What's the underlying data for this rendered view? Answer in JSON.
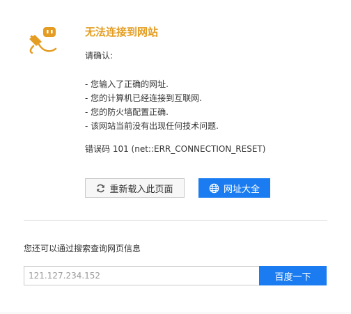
{
  "error": {
    "icon": "unplugged-plug-icon",
    "title": "无法连接到网站",
    "confirm_label": "请确认:",
    "checks": [
      "- 您输入了正确的网址.",
      "- 您的计算机已经连接到互联网.",
      "- 您的防火墙配置正确.",
      "- 该网站当前没有出现任何技术问题."
    ],
    "error_code": "错误码 101 (net::ERR_CONNECTION_RESET)"
  },
  "actions": {
    "reload_label": "重新载入此页面",
    "reload_icon": "refresh-icon",
    "sites_label": "网址大全",
    "sites_icon": "globe-icon"
  },
  "search": {
    "label": "您还可以通过搜索查询网页信息",
    "query_value": "121.127.234.152",
    "button_label": "百度一下"
  },
  "colors": {
    "title_accent": "#e49d22",
    "primary_blue": "#1a7cf0"
  }
}
